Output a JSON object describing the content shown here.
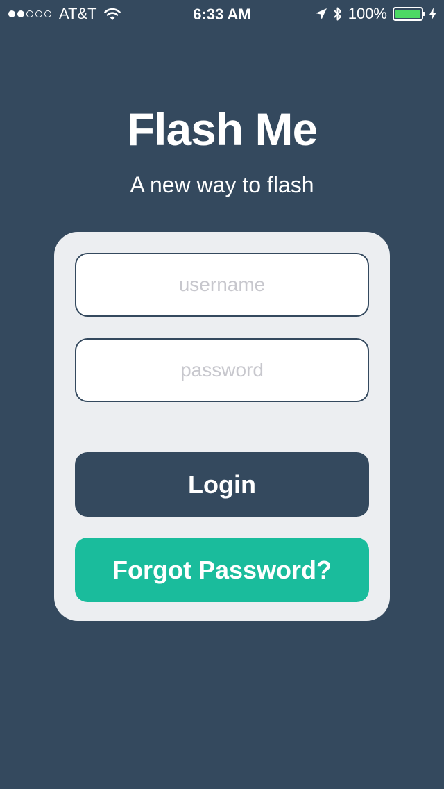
{
  "status_bar": {
    "carrier": "AT&T",
    "time": "6:33 AM",
    "battery_percent": "100%",
    "signal_strength": 2,
    "signal_max": 5,
    "battery_level": 1.0,
    "icons": [
      "wifi-icon",
      "location-arrow-icon",
      "bluetooth-icon",
      "battery-icon",
      "charging-bolt-icon"
    ]
  },
  "app": {
    "title": "Flash Me",
    "subtitle": "A new way to flash"
  },
  "login_form": {
    "username_placeholder": "username",
    "password_placeholder": "password",
    "login_label": "Login",
    "forgot_label": "Forgot Password?"
  },
  "colors": {
    "background": "#34495e",
    "card": "#eceef1",
    "primary": "#34495e",
    "accent": "#1abc9c",
    "battery": "#4cd964"
  }
}
